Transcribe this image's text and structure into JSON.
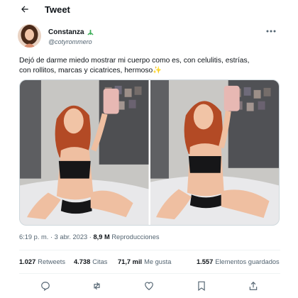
{
  "header": {
    "title": "Tweet",
    "back_icon": "arrow-left-icon"
  },
  "author": {
    "display_name": "Constanza",
    "handle": "@cotyrommero",
    "badge_icon": "cactus-emoji-icon",
    "more_icon": "more-dots-icon"
  },
  "tweet": {
    "text_line1": "Dejó de darme miedo mostrar mi cuerpo como es, con celulitis, estrías,",
    "text_line2": "con rollitos, marcas y cicatrices, hermoso",
    "emoji": "✨",
    "photos": [
      "selfie-photo-1",
      "selfie-photo-2"
    ]
  },
  "meta": {
    "time": "6:19 p. m.",
    "separator": "·",
    "date": "3 abr. 2023",
    "views_value": "8,9 M",
    "views_label": "Reproducciones"
  },
  "stats": [
    {
      "value": "1.027",
      "label": "Retweets"
    },
    {
      "value": "4.738",
      "label": "Citas"
    },
    {
      "value": "71,7 mil",
      "label": "Me gusta"
    },
    {
      "value": "1.557",
      "label": "Elementos guardados"
    }
  ],
  "actions": [
    "reply-icon",
    "retweet-icon",
    "like-icon",
    "bookmark-icon",
    "share-icon"
  ],
  "colors": {
    "text": "#0f1419",
    "secondary": "#536471",
    "divider": "#eff3f4"
  }
}
